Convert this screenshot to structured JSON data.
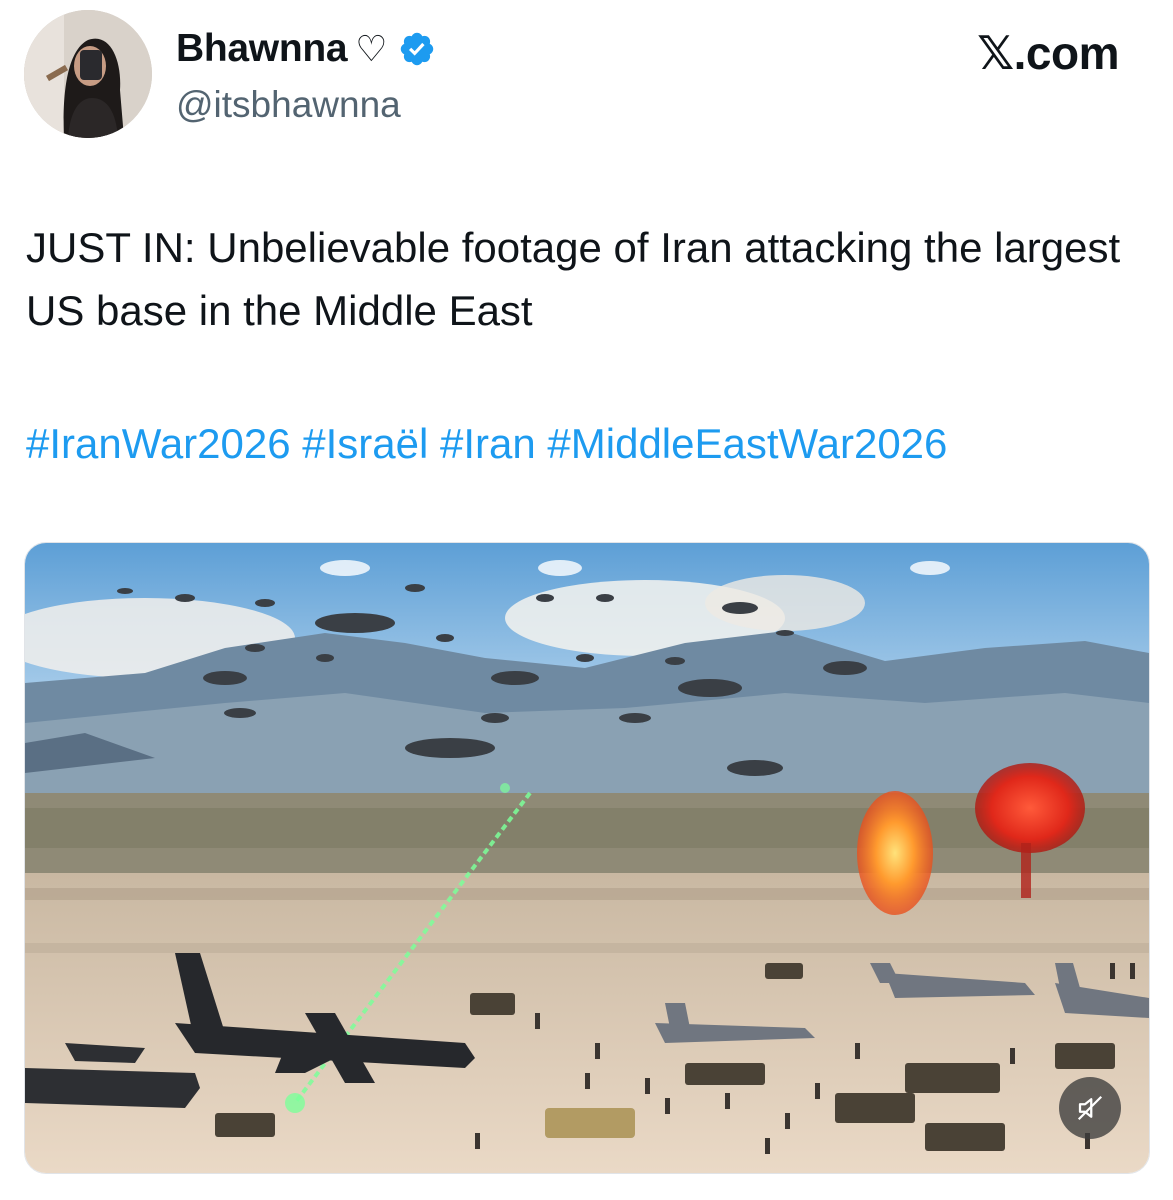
{
  "author": {
    "display_name": "Bhawnna",
    "name_emoji": "♡",
    "handle": "@itsbhawnna",
    "verified": true,
    "verified_color": "#1d9bf0"
  },
  "source": {
    "brand": "𝕏.com"
  },
  "tweet": {
    "text": "JUST IN: Unbelievable footage of Iran attacking the largest US base in the Middle East",
    "hashtags": [
      "#IranWar2026",
      "#Israël",
      "#Iran",
      "#MiddleEastWar2026"
    ],
    "hashtag_color": "#1d9bf0"
  },
  "media": {
    "type": "video",
    "muted_icon": "speaker-muted-icon"
  }
}
